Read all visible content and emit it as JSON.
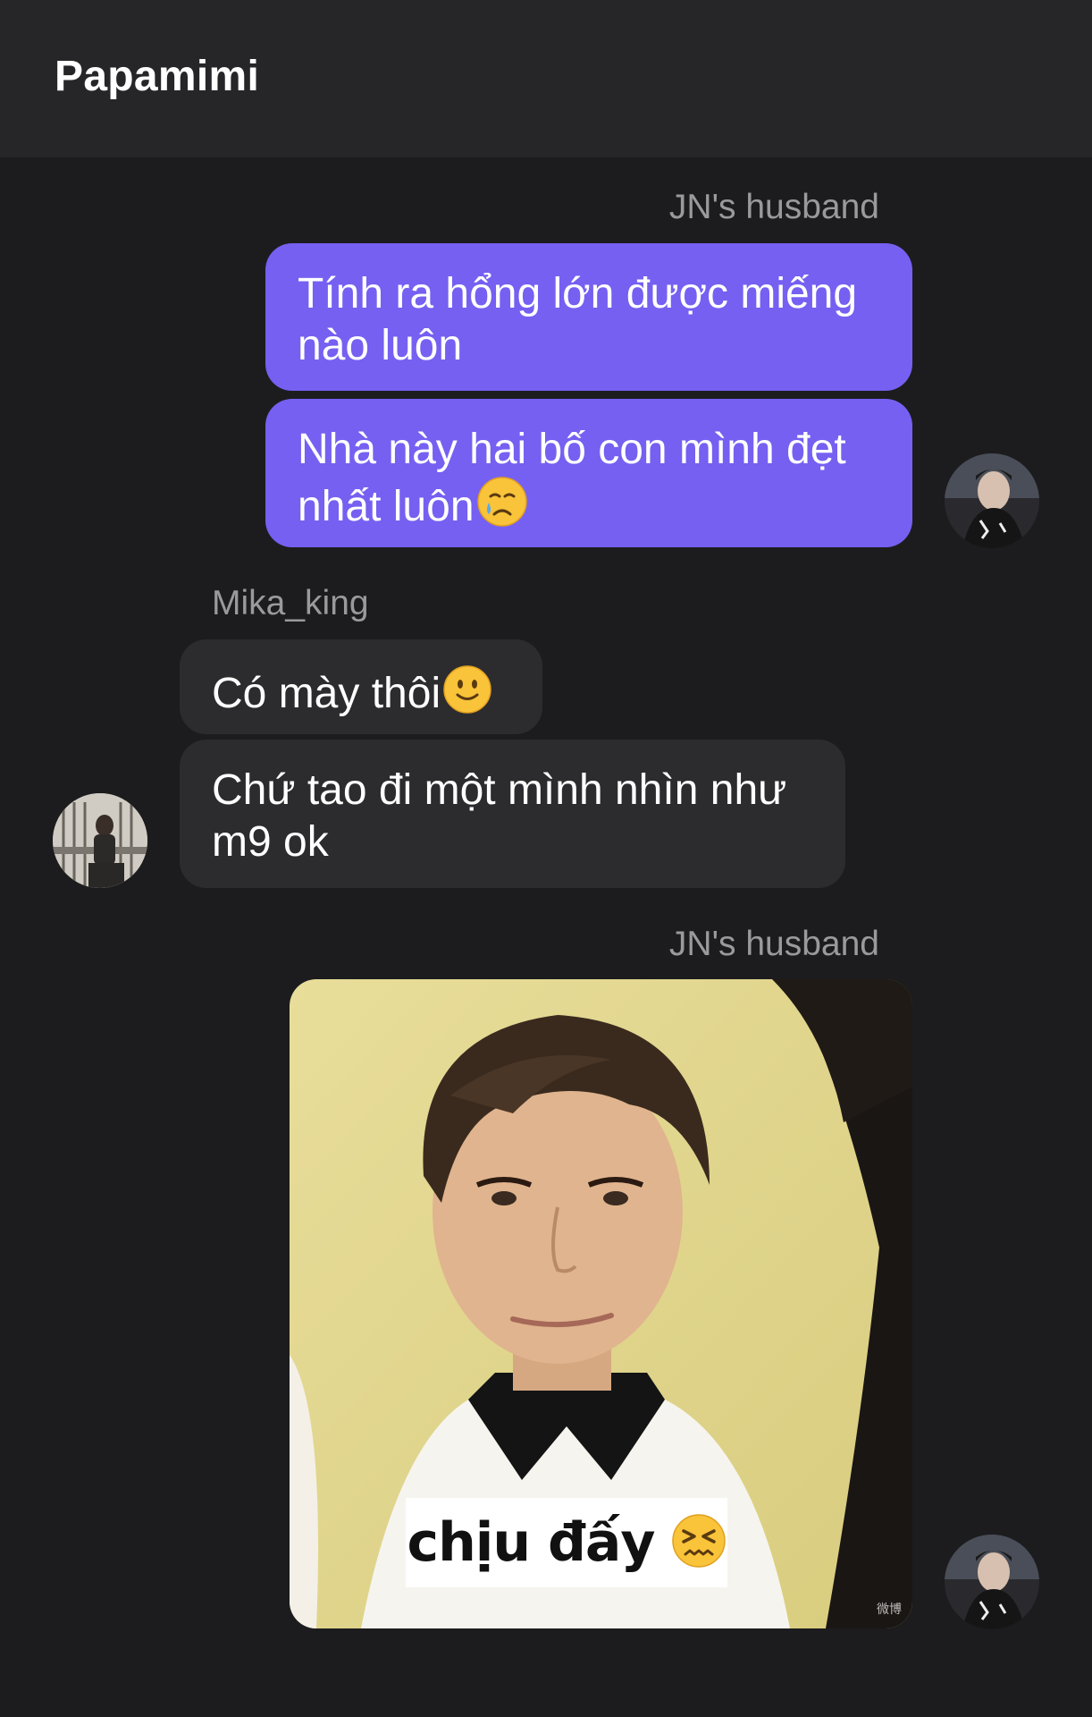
{
  "header": {
    "title": "Papamimi"
  },
  "colors": {
    "background": "#1c1c1e",
    "header": "#262628",
    "outgoing_bubble": "#7560f2",
    "incoming_bubble": "#2c2c2e",
    "sender_name": "#9a9a9e"
  },
  "messages": {
    "group1": {
      "sender": "JN's husband",
      "bubble1": "Tính ra hổng lớn được miếng nào luôn",
      "bubble2_line1": "Nhà này hai bố con mình đẹt",
      "bubble2_line2": "nhất luôn",
      "bubble2_emoji": "crying-face-icon"
    },
    "group2": {
      "sender": "Mika_king",
      "bubble1": "Có mày thôi",
      "bubble1_emoji": "slightly-smiling-face-icon",
      "bubble2": "Chứ tao đi một mình nhìn như m9 ok"
    },
    "group3": {
      "sender": "JN's husband",
      "image_caption": "chịu đấy",
      "image_caption_emoji": "confounded-face-icon",
      "image_watermark": "微博"
    }
  }
}
